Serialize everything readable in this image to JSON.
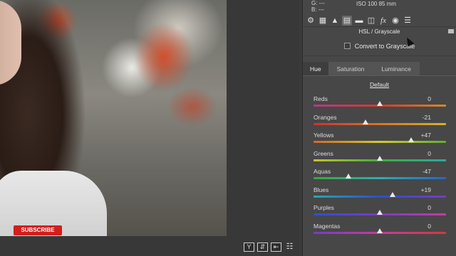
{
  "meta": {
    "rgb_lines": [
      "G:  ---",
      "B:  ---"
    ],
    "camera_info": "ISO 100   85 mm"
  },
  "panel_tabs": [
    {
      "icon": "basic-icon",
      "glyph": "⚙"
    },
    {
      "icon": "tone-curve-icon",
      "glyph": "▦"
    },
    {
      "icon": "detail-icon",
      "glyph": "▲"
    },
    {
      "icon": "hsl-icon",
      "glyph": "▤",
      "active": true
    },
    {
      "icon": "split-toning-icon",
      "glyph": "▬"
    },
    {
      "icon": "lens-corrections-icon",
      "glyph": "◫"
    },
    {
      "icon": "effects-icon",
      "glyph": "fx"
    },
    {
      "icon": "camera-calibration-icon",
      "glyph": "◉"
    },
    {
      "icon": "presets-icon",
      "glyph": "☰"
    }
  ],
  "section_title": "HSL / Grayscale",
  "grayscale_label": "Convert to Grayscale",
  "grayscale_checked": false,
  "hsl_tabs": [
    {
      "label": "Hue",
      "active": true
    },
    {
      "label": "Saturation",
      "active": false
    },
    {
      "label": "Luminance",
      "active": false
    }
  ],
  "default_label": "Default",
  "sliders": [
    {
      "label": "Reds",
      "value": 0,
      "display": "0",
      "gradient": [
        "#b03a8c",
        "#d63a2a",
        "#d08a2a"
      ]
    },
    {
      "label": "Oranges",
      "value": -21,
      "display": "-21",
      "gradient": [
        "#c8352e",
        "#d8742a",
        "#cfb52a"
      ]
    },
    {
      "label": "Yellows",
      "value": 47,
      "display": "+47",
      "gradient": [
        "#cf6a2a",
        "#d5c92c",
        "#5fb032"
      ]
    },
    {
      "label": "Greens",
      "value": 0,
      "display": "0",
      "gradient": [
        "#c5c52c",
        "#3fae3a",
        "#2aa8a0"
      ]
    },
    {
      "label": "Aquas",
      "value": -47,
      "display": "-47",
      "gradient": [
        "#3aa83a",
        "#2ab0b0",
        "#2a63c8"
      ]
    },
    {
      "label": "Blues",
      "value": 19,
      "display": "+19",
      "gradient": [
        "#2aa8b0",
        "#2a4fd0",
        "#7a3ac8"
      ]
    },
    {
      "label": "Purples",
      "value": 0,
      "display": "0",
      "gradient": [
        "#3050d0",
        "#7a3ac8",
        "#c83aa8"
      ]
    },
    {
      "label": "Magentas",
      "value": 0,
      "display": "0",
      "gradient": [
        "#7a3ac8",
        "#c83aa0",
        "#d23a3a"
      ]
    }
  ],
  "slider_range": [
    -100,
    100
  ],
  "overlay": {
    "subscribe_label": "SUBSCRIBE"
  },
  "view_tools": [
    {
      "name": "view-mode-button",
      "glyph": "Y"
    },
    {
      "name": "before-after-toggle-button",
      "glyph": "⇵"
    },
    {
      "name": "swap-settings-button",
      "glyph": "⇤"
    },
    {
      "name": "settings-sliders-icon",
      "glyph": "☷"
    }
  ]
}
